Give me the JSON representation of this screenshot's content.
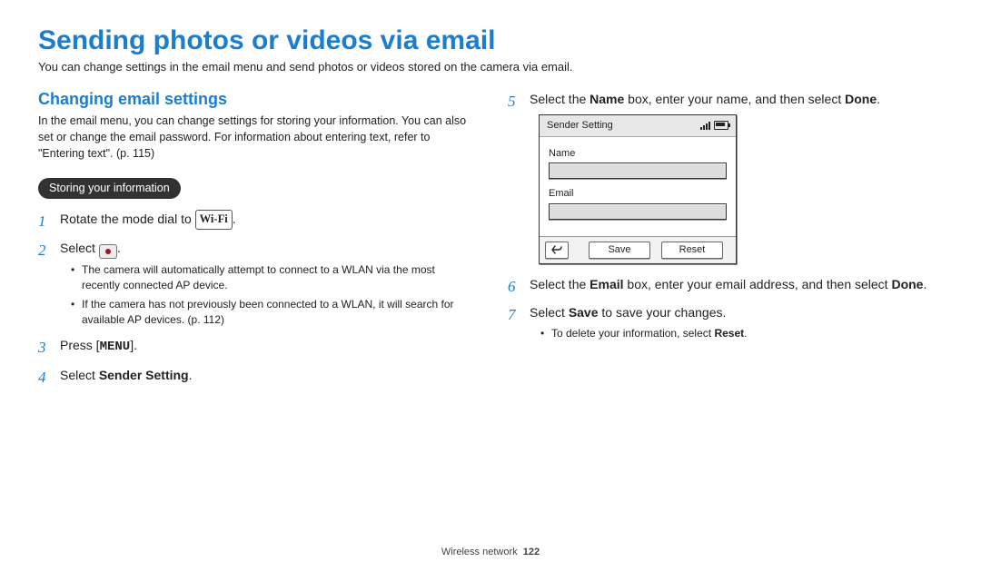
{
  "title": "Sending photos or videos via email",
  "lead": "You can change settings in the email menu and send photos or videos stored on the camera via email.",
  "section_h": "Changing email settings",
  "section_p": "In the email menu, you can change settings for storing your information. You can also set or change the email password. For information about entering text, refer to \"Entering text\". (p. 115)",
  "pill": "Storing your information",
  "wifi_label": "Wi-Fi",
  "menu_label": "MENU",
  "steps": {
    "s1_a": "Rotate the mode dial to ",
    "s1_b": ".",
    "s2_a": "Select ",
    "s2_b": ".",
    "s2_bul1": "The camera will automatically attempt to connect to a WLAN via the most recently connected AP device.",
    "s2_bul2": "If the camera has not previously been connected to a WLAN, it will search for available AP devices. (p. 112)",
    "s3_a": "Press [",
    "s3_b": "].",
    "s4_a": "Select ",
    "s4_strong": "Sender Setting",
    "s4_b": ".",
    "s5_a": "Select the ",
    "s5_strong1": "Name",
    "s5_b": " box, enter your name, and then select ",
    "s5_strong2": "Done",
    "s5_c": ".",
    "s6_a": "Select the ",
    "s6_strong1": "Email",
    "s6_b": " box, enter your email address, and then select ",
    "s6_strong2": "Done",
    "s6_c": ".",
    "s7_a": "Select ",
    "s7_strong": "Save",
    "s7_b": " to save your changes.",
    "s7_bul1_a": "To delete your information, select ",
    "s7_bul1_strong": "Reset",
    "s7_bul1_b": "."
  },
  "screen": {
    "title": "Sender Setting",
    "name_lbl": "Name",
    "email_lbl": "Email",
    "save": "Save",
    "reset": "Reset"
  },
  "footer_a": "Wireless network",
  "footer_b": "122"
}
